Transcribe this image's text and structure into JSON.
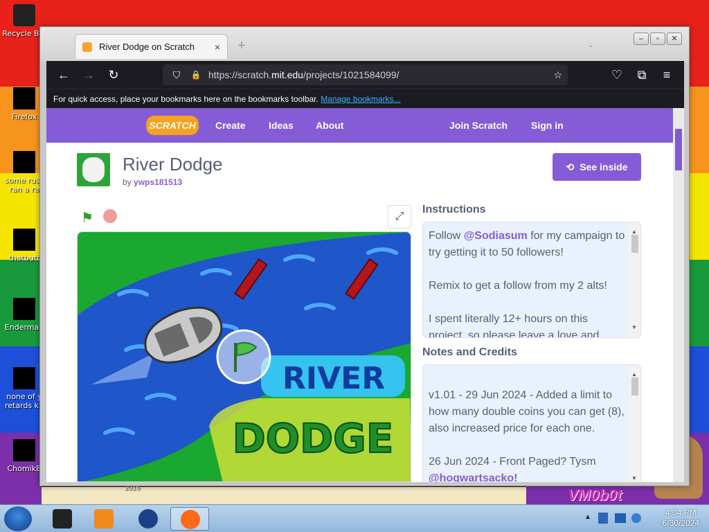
{
  "desktop": {
    "icons": [
      {
        "label": "Recycle Bin"
      },
      {
        "label": "Firefox"
      },
      {
        "label": "some russ ran a ra"
      },
      {
        "label": "thatbutt"
      },
      {
        "label": "Enderman"
      },
      {
        "label": "none of y retards kn"
      },
      {
        "label": "ChomikB"
      }
    ],
    "watermark": "VM0b0t",
    "small_label": "2016"
  },
  "browser": {
    "tab_title": "River Dodge on Scratch",
    "tab_close": "×",
    "new_tab": "+",
    "tab_list": "⌄",
    "url_prefix": "https://scratch.",
    "url_host": "mit.edu",
    "url_path": "/projects/1021584099/",
    "bookmarks_text": "For quick access, place your bookmarks here on the bookmarks toolbar.",
    "bookmarks_link": "Manage bookmarks...",
    "icons": {
      "back": "←",
      "forward": "→",
      "reload": "↻",
      "shield": "⛉",
      "lock": "🔒",
      "star": "☆",
      "pocket": "♡",
      "extensions": "⧉",
      "menu": "≡"
    }
  },
  "scratch": {
    "logo": "SCRATCH",
    "nav": [
      "Create",
      "Ideas",
      "About"
    ],
    "join": "Join Scratch",
    "signin": "Sign in",
    "project_title": "River Dodge",
    "by_prefix": "by",
    "author": "ywps181513",
    "see_inside": "See inside",
    "stage_text_1": "RIVER",
    "stage_text_2": "DODGE",
    "instructions_heading": "Instructions",
    "instructions": {
      "p1_pre": "Follow ",
      "p1_mention": "@Sodiasum",
      "p1_post": " for my campaign to try getting it to 50 followers!",
      "p2": "Remix to get a follow from my 2 alts!",
      "p3": "I spent literally 12+ hours on this project, so please leave a love and"
    },
    "notes_heading": "Notes and Credits",
    "notes": {
      "p1": "v1.01 - 29 Jun 2024 - Added a limit to how many double coins you can get (8), also increased price for each one.",
      "p2": "26 Jun 2024 - Front Paged? Tysm",
      "p3_mention": "@hogwartsacko!"
    }
  },
  "taskbar": {
    "time": "4:04 PM",
    "date": "6/30/2024"
  },
  "colors": {
    "scratch_purple": "#855cd6",
    "text_gray": "#575e75",
    "browser_dark": "#1c1b22",
    "link_blue": "#3ab0ff"
  }
}
